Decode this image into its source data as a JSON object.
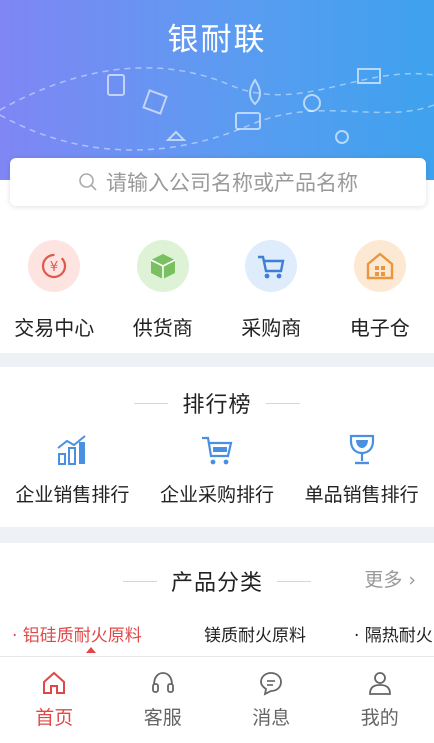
{
  "header": {
    "title": "银耐联"
  },
  "search": {
    "placeholder": "请输入公司名称或产品名称"
  },
  "quick_nav": [
    {
      "label": "交易中心",
      "icon": "exchange-icon"
    },
    {
      "label": "供货商",
      "icon": "supplier-box-icon"
    },
    {
      "label": "采购商",
      "icon": "cart-icon"
    },
    {
      "label": "电子仓",
      "icon": "warehouse-icon"
    }
  ],
  "ranking": {
    "title": "排行榜",
    "items": [
      {
        "label": "企业销售排行",
        "icon": "bar-chart-icon"
      },
      {
        "label": "企业采购排行",
        "icon": "cart-icon"
      },
      {
        "label": "单品销售排行",
        "icon": "trophy-icon"
      }
    ]
  },
  "categories": {
    "title": "产品分类",
    "more": "更多",
    "tabs": [
      {
        "label": "· 铝硅质耐火原料",
        "active": true
      },
      {
        "label": "镁质耐火原料",
        "active": false
      },
      {
        "label": "· 隔热耐火",
        "active": false
      }
    ]
  },
  "tabbar": [
    {
      "label": "首页",
      "icon": "home-icon",
      "active": true
    },
    {
      "label": "客服",
      "icon": "headset-icon",
      "active": false
    },
    {
      "label": "消息",
      "icon": "chat-icon",
      "active": false
    },
    {
      "label": "我的",
      "icon": "user-icon",
      "active": false
    }
  ],
  "colors": {
    "accent": "#e04848",
    "header_start": "#7f86f4",
    "header_end": "#3ea2ee",
    "icon_blue": "#4a90e2"
  }
}
